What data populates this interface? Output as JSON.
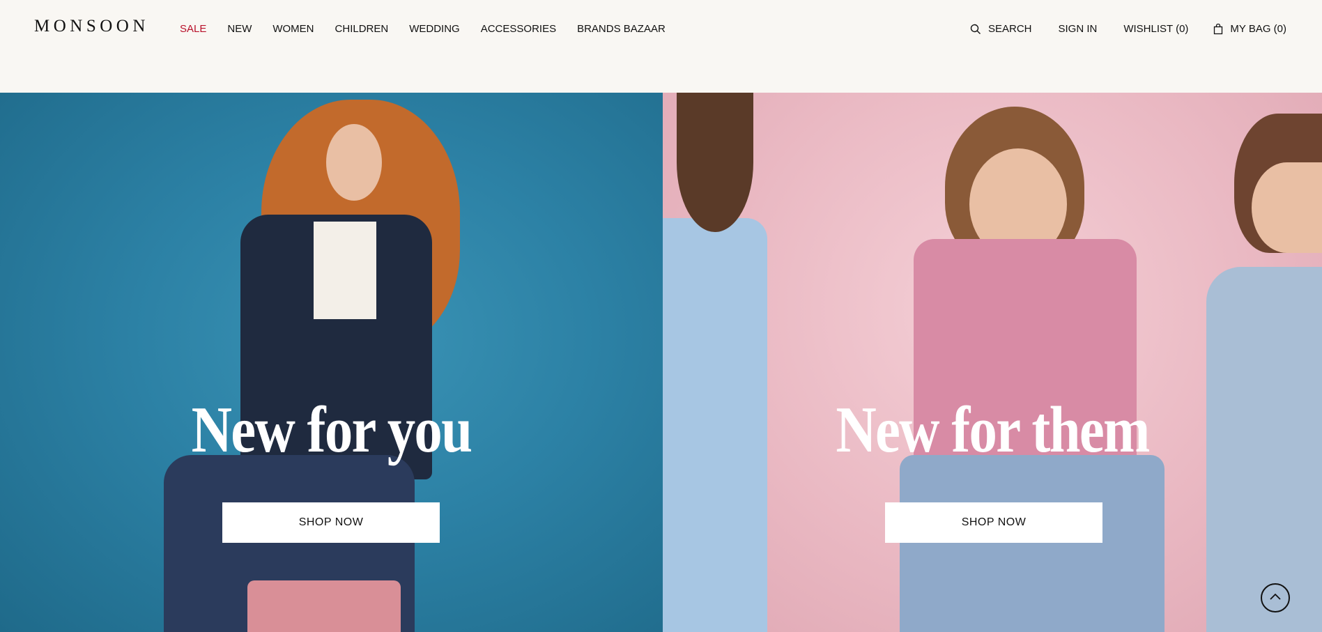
{
  "brand": {
    "logo_text": "MONSOON"
  },
  "nav": {
    "items": [
      {
        "label": "SALE"
      },
      {
        "label": "NEW"
      },
      {
        "label": "WOMEN"
      },
      {
        "label": "CHILDREN"
      },
      {
        "label": "WEDDING"
      },
      {
        "label": "ACCESSORIES"
      },
      {
        "label": "BRANDS BAZAAR"
      }
    ]
  },
  "utilities": {
    "search_label": "SEARCH",
    "signin_label": "SIGN IN",
    "wishlist_label": "WISHLIST (0)",
    "bag_label": "MY BAG (0)"
  },
  "hero": {
    "left": {
      "headline": "New for you",
      "button_label": "SHOP NOW"
    },
    "right": {
      "headline": "New for them",
      "button_label": "SHOP NOW"
    }
  },
  "colors": {
    "sale": "#b8102a",
    "header_bg": "#f9f7f3",
    "left_panel": "#2c81a5",
    "right_panel": "#eab9c3"
  },
  "icons": [
    "search-icon",
    "bag-icon",
    "chevron-up-icon"
  ]
}
